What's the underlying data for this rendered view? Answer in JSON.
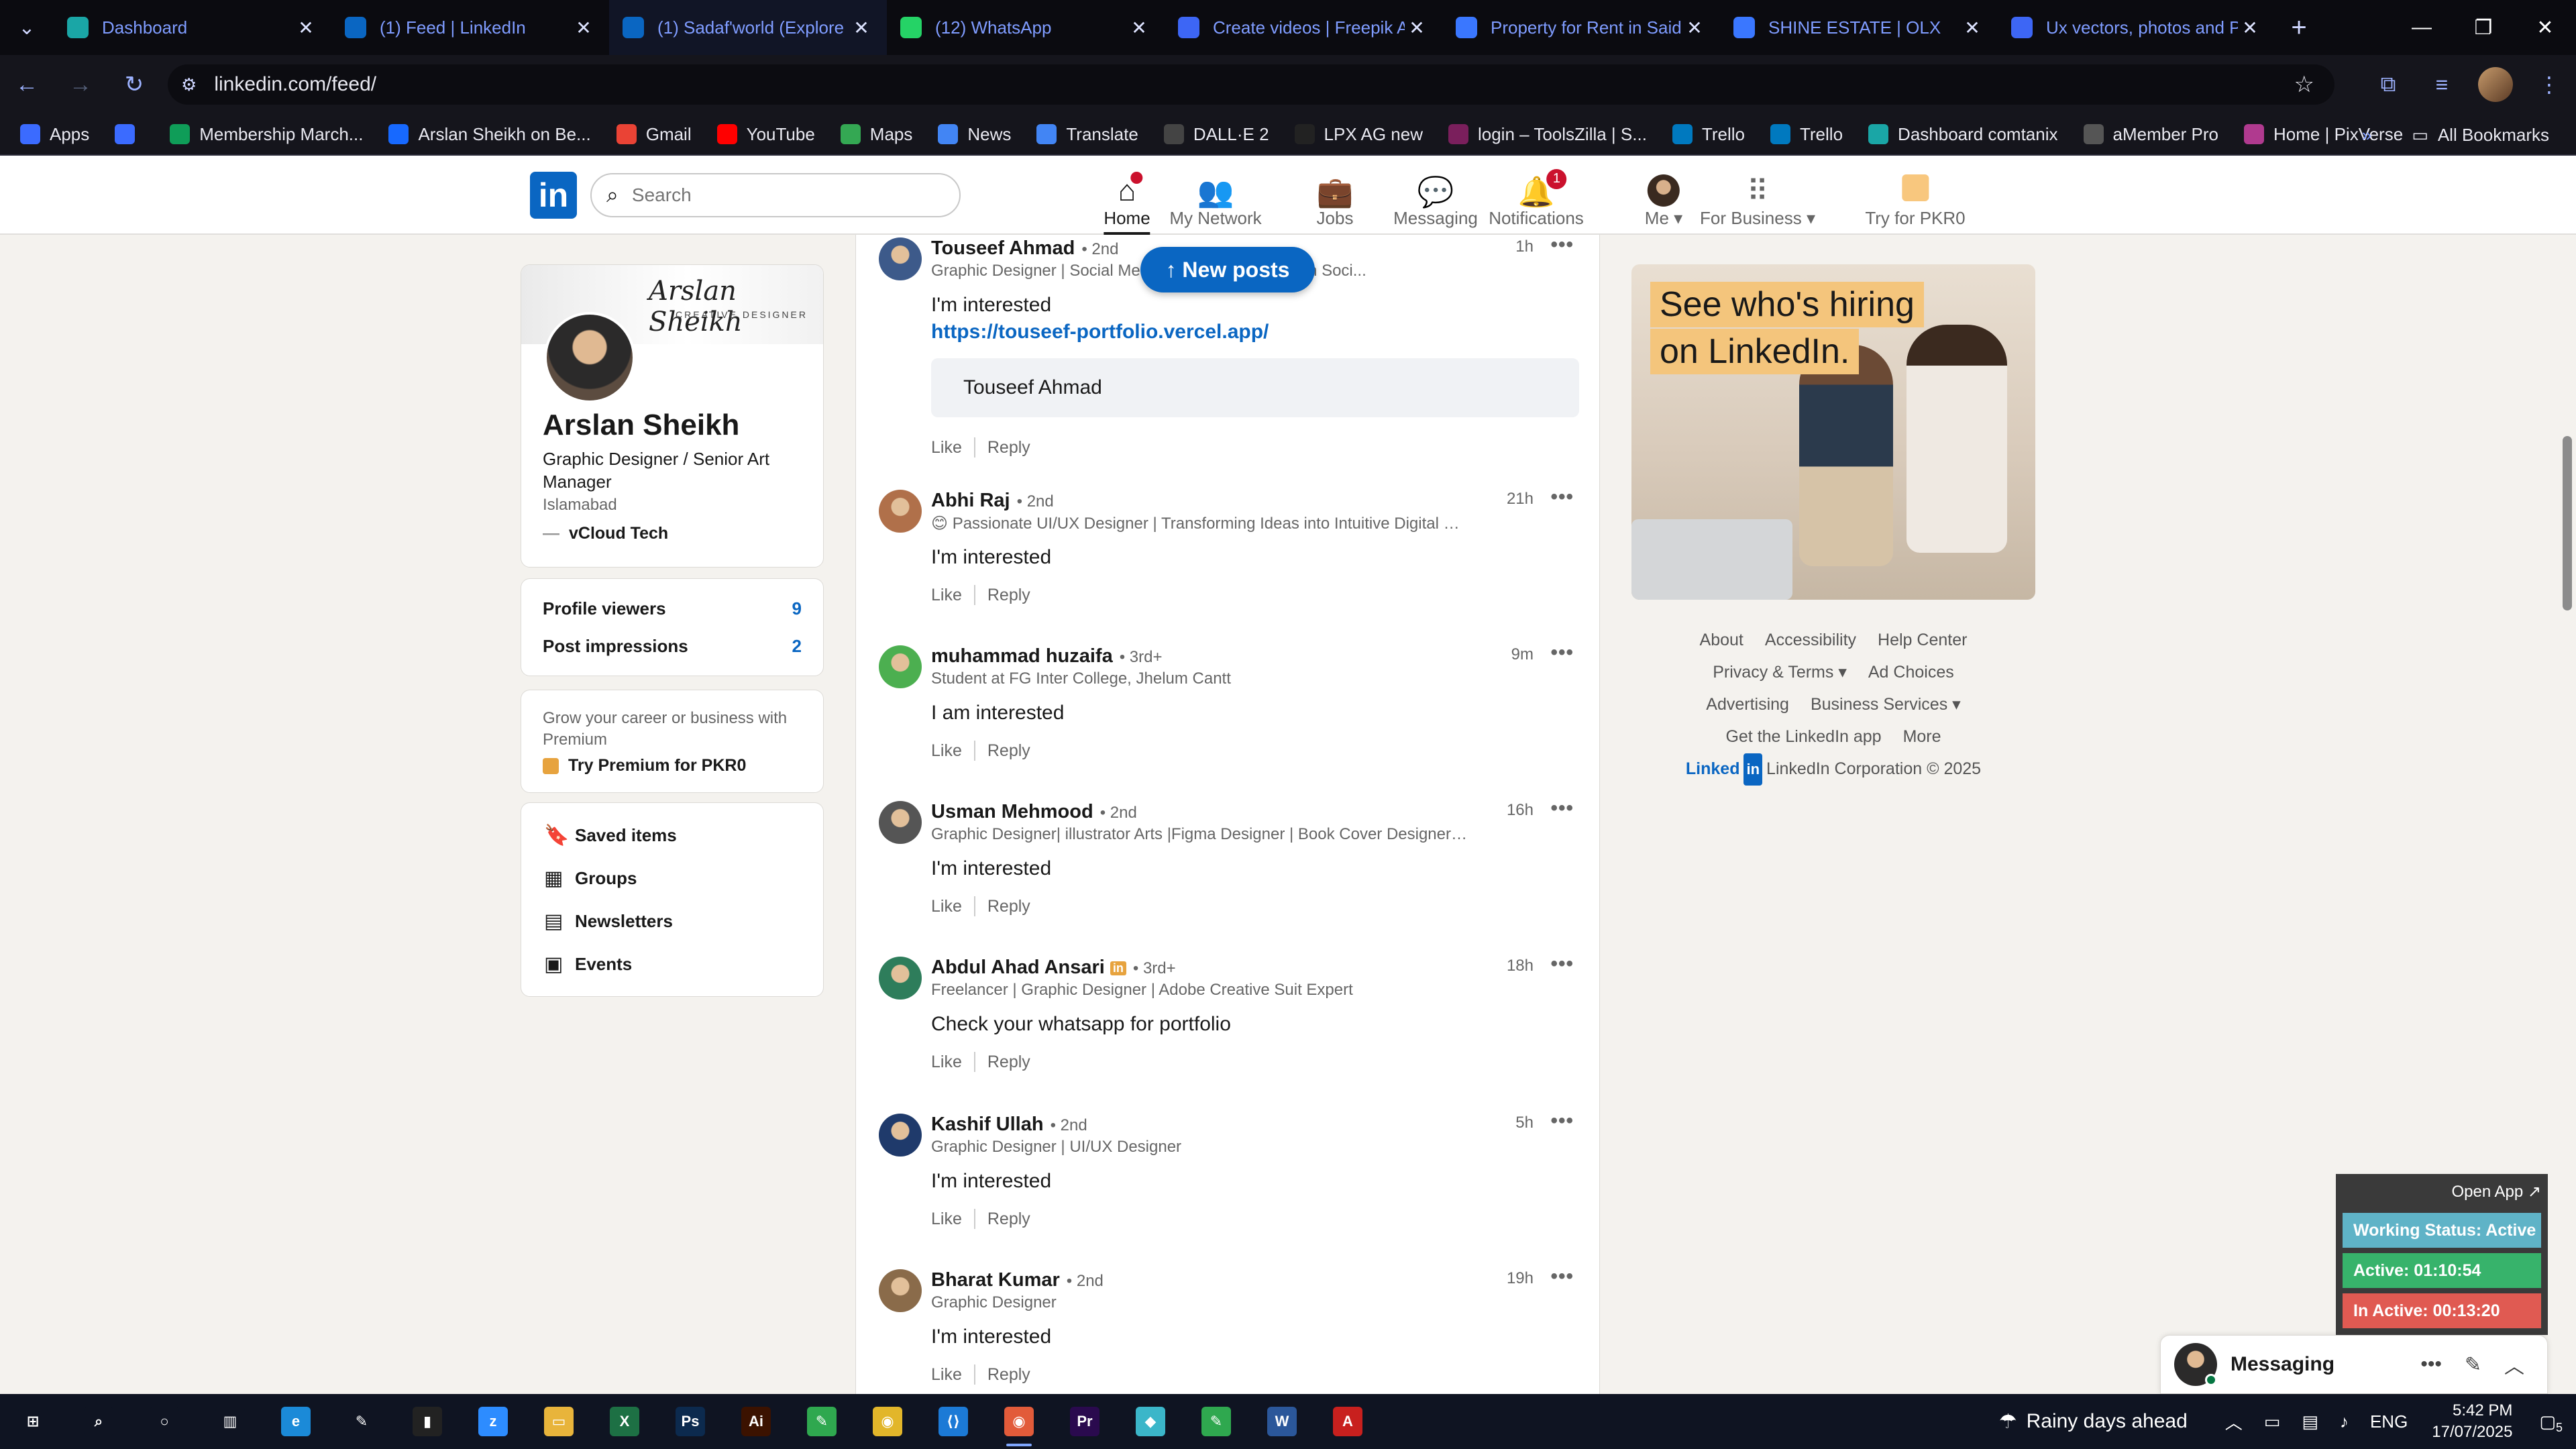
{
  "browser": {
    "tabs": [
      {
        "title": "Dashboard",
        "icon": "dashboard-tab-icon",
        "color": "#1aa6a6",
        "active": false
      },
      {
        "title": "(1) Feed | LinkedIn",
        "icon": "linkedin-tab-icon",
        "color": "#0a66c2",
        "active": false
      },
      {
        "title": "(1) Sadaf'world (Explore",
        "icon": "linkedin-tab-icon",
        "color": "#0a66c2",
        "active": true
      },
      {
        "title": "(12) WhatsApp",
        "icon": "whatsapp-tab-icon",
        "color": "#25d366",
        "active": false
      },
      {
        "title": "Create videos | Freepik AI",
        "icon": "freepik-tab-icon",
        "color": "#3d66f5",
        "active": false
      },
      {
        "title": "Property for Rent in Saidp",
        "icon": "olx-tab-icon",
        "color": "#3a77ff",
        "active": false
      },
      {
        "title": "SHINE ESTATE | OLX",
        "icon": "olx-tab-icon",
        "color": "#3a77ff",
        "active": false
      },
      {
        "title": "Ux vectors, photos and P",
        "icon": "freepik-tab-icon",
        "color": "#3d66f5",
        "active": false
      }
    ],
    "url": "linkedin.com/feed/",
    "bookmarks": [
      {
        "label": "Apps",
        "color": "#3b6bff"
      },
      {
        "label": "",
        "color": "#3b6bff"
      },
      {
        "label": "Membership March...",
        "color": "#0f9d58"
      },
      {
        "label": "Arslan Sheikh on Be...",
        "color": "#1769ff"
      },
      {
        "label": "Gmail",
        "color": "#ea4335"
      },
      {
        "label": "YouTube",
        "color": "#ff0000"
      },
      {
        "label": "Maps",
        "color": "#34a853"
      },
      {
        "label": "News",
        "color": "#4285f4"
      },
      {
        "label": "Translate",
        "color": "#4285f4"
      },
      {
        "label": "DALL·E 2",
        "color": "#444444"
      },
      {
        "label": "LPX AG new",
        "color": "#222222"
      },
      {
        "label": "login – ToolsZilla | S...",
        "color": "#7a1f5c"
      },
      {
        "label": "Trello",
        "color": "#0079bf"
      },
      {
        "label": "Trello",
        "color": "#0079bf"
      },
      {
        "label": "Dashboard comtanix",
        "color": "#1aa6a6"
      },
      {
        "label": "aMember Pro",
        "color": "#555555"
      },
      {
        "label": "Home | PixVerse",
        "color": "#b03a8f"
      }
    ],
    "all_bookmarks": "All Bookmarks"
  },
  "header": {
    "search_placeholder": "Search",
    "nav": [
      {
        "label": "Home",
        "icon": "home-icon",
        "badge": ""
      },
      {
        "label": "My Network",
        "icon": "network-icon",
        "badge": ""
      },
      {
        "label": "Jobs",
        "icon": "jobs-icon",
        "badge": ""
      },
      {
        "label": "Messaging",
        "icon": "messaging-icon",
        "badge": ""
      },
      {
        "label": "Notifications",
        "icon": "bell-icon",
        "badge": "1"
      },
      {
        "label": "Me ▾",
        "icon": "avatar",
        "badge": ""
      },
      {
        "label": "For Business ▾",
        "icon": "grid-icon",
        "badge": ""
      },
      {
        "label": "Try for PKR0",
        "icon": "premium-icon",
        "badge": ""
      }
    ]
  },
  "profile": {
    "name": "Arslan Sheikh",
    "headline": "Graphic Designer / Senior Art Manager",
    "location": "Islamabad",
    "company": "vCloud Tech",
    "cover_signature": "Arslan Sheikh",
    "cover_tag": "CREATIVE DESIGNER",
    "stats": [
      {
        "label": "Profile viewers",
        "value": "9"
      },
      {
        "label": "Post impressions",
        "value": "2"
      }
    ],
    "premium_text": "Grow your career or business with Premium",
    "premium_link": "Try Premium for PKR0",
    "menu": [
      {
        "label": "Saved items",
        "icon": "bookmark-icon"
      },
      {
        "label": "Groups",
        "icon": "groups-icon"
      },
      {
        "label": "Newsletters",
        "icon": "newsletter-icon"
      },
      {
        "label": "Events",
        "icon": "calendar-icon"
      }
    ]
  },
  "new_posts": "↑ New posts",
  "comments": [
    {
      "name": "Touseef Ahmad",
      "degree": "• 2nd",
      "sub": "Graphic Designer | Social Media ... ds | Specializing in Soci...",
      "time": "1h",
      "text": "I'm interested",
      "link": "https://touseef-portfolio.vercel.app/",
      "quote": "Touseef Ahmad",
      "color": "#3d5a8a"
    },
    {
      "name": "Abhi Raj",
      "degree": "• 2nd",
      "sub": "😊 Passionate UI/UX Designer | Transforming Ideas into Intuitive Digital Exp...",
      "time": "21h",
      "text": "I'm interested",
      "color": "#b0704a"
    },
    {
      "name": "muhammad huzaifa",
      "degree": "• 3rd+",
      "sub": "Student at FG Inter College, Jhelum Cantt",
      "time": "9m",
      "text": "I am interested",
      "color": "#4caf50"
    },
    {
      "name": "Usman Mehmood",
      "degree": "• 2nd",
      "sub": "Graphic Designer| illustrator Arts |Figma Designer | Book Cover Designer | lo...",
      "time": "16h",
      "text": "I'm interested",
      "color": "#555555"
    },
    {
      "name": "Abdul Ahad Ansari",
      "degree": "• 3rd+",
      "sub": "Freelancer | Graphic Designer | Adobe Creative Suit Expert",
      "time": "18h",
      "text": "Check your whatsapp for portfolio",
      "color": "#2e7d5b"
    },
    {
      "name": "Kashif Ullah",
      "degree": "• 2nd",
      "sub": "Graphic Designer | UI/UX Designer",
      "time": "5h",
      "text": "I'm interested",
      "color": "#1f3a6b"
    },
    {
      "name": "Bharat Kumar",
      "degree": "• 2nd",
      "sub": "Graphic Designer",
      "time": "19h",
      "text": "I'm interested",
      "color": "#8a6b4a"
    }
  ],
  "comment_actions": {
    "like": "Like",
    "reply": "Reply"
  },
  "ad": {
    "line1": "See who's hiring",
    "line2": "on LinkedIn."
  },
  "footer": {
    "row1": [
      "About",
      "Accessibility",
      "Help Center"
    ],
    "row2": [
      "Privacy & Terms ▾",
      "Ad Choices"
    ],
    "row3": [
      "Advertising",
      "Business Services ▾"
    ],
    "row4": [
      "Get the LinkedIn app",
      "More"
    ],
    "brand": "Linked",
    "brand_in": "in",
    "copyright": "LinkedIn Corporation © 2025"
  },
  "work_status": {
    "open_app": "Open App ↗",
    "status": "Working Status: Active",
    "active": "Active: 01:10:54",
    "inactive": "In Active: 00:13:20",
    "colors": {
      "status": "#5fb3c7",
      "active": "#37b36b",
      "inactive": "#e05a52"
    }
  },
  "messaging": {
    "title": "Messaging"
  },
  "taskbar": {
    "weather": "Rainy days ahead",
    "lang": "ENG",
    "time": "5:42 PM",
    "date": "17/07/2025",
    "notif_count": "5",
    "apps": [
      {
        "name": "start-button",
        "glyph": "⊞",
        "color": "#0f1422"
      },
      {
        "name": "search-icon",
        "glyph": "⌕",
        "color": "#0f1422"
      },
      {
        "name": "cortana-icon",
        "glyph": "○",
        "color": "#0f1422"
      },
      {
        "name": "task-view-icon",
        "glyph": "▥",
        "color": "#0f1422"
      },
      {
        "name": "edge-icon",
        "glyph": "e",
        "color": "#1b8ad8"
      },
      {
        "name": "pen-icon",
        "glyph": "✎",
        "color": "#0f1422"
      },
      {
        "name": "terminal-icon",
        "glyph": "▮",
        "color": "#222222"
      },
      {
        "name": "zoom-icon",
        "glyph": "z",
        "color": "#2d8cff"
      },
      {
        "name": "file-explorer-icon",
        "glyph": "▭",
        "color": "#e8b43b"
      },
      {
        "name": "excel-icon",
        "glyph": "X",
        "color": "#1d7044"
      },
      {
        "name": "photoshop-icon",
        "glyph": "Ps",
        "color": "#0c2a4e"
      },
      {
        "name": "illustrator-icon",
        "glyph": "Ai",
        "color": "#3b1200"
      },
      {
        "name": "app-green-icon",
        "glyph": "✎",
        "color": "#2fa84f"
      },
      {
        "name": "chrome-icon",
        "glyph": "◉",
        "color": "#e2b62a"
      },
      {
        "name": "vscode-icon",
        "glyph": "⟨⟩",
        "color": "#1c7ad6"
      },
      {
        "name": "chrome-active-icon",
        "glyph": "◉",
        "color": "#e25b3a"
      },
      {
        "name": "premiere-icon",
        "glyph": "Pr",
        "color": "#2a0a4e"
      },
      {
        "name": "app-teal-icon",
        "glyph": "◆",
        "color": "#3bb6c9"
      },
      {
        "name": "app-green2-icon",
        "glyph": "✎",
        "color": "#2fa84f"
      },
      {
        "name": "word-icon",
        "glyph": "W",
        "color": "#2b579a"
      },
      {
        "name": "acrobat-icon",
        "glyph": "A",
        "color": "#c8201e"
      }
    ]
  }
}
